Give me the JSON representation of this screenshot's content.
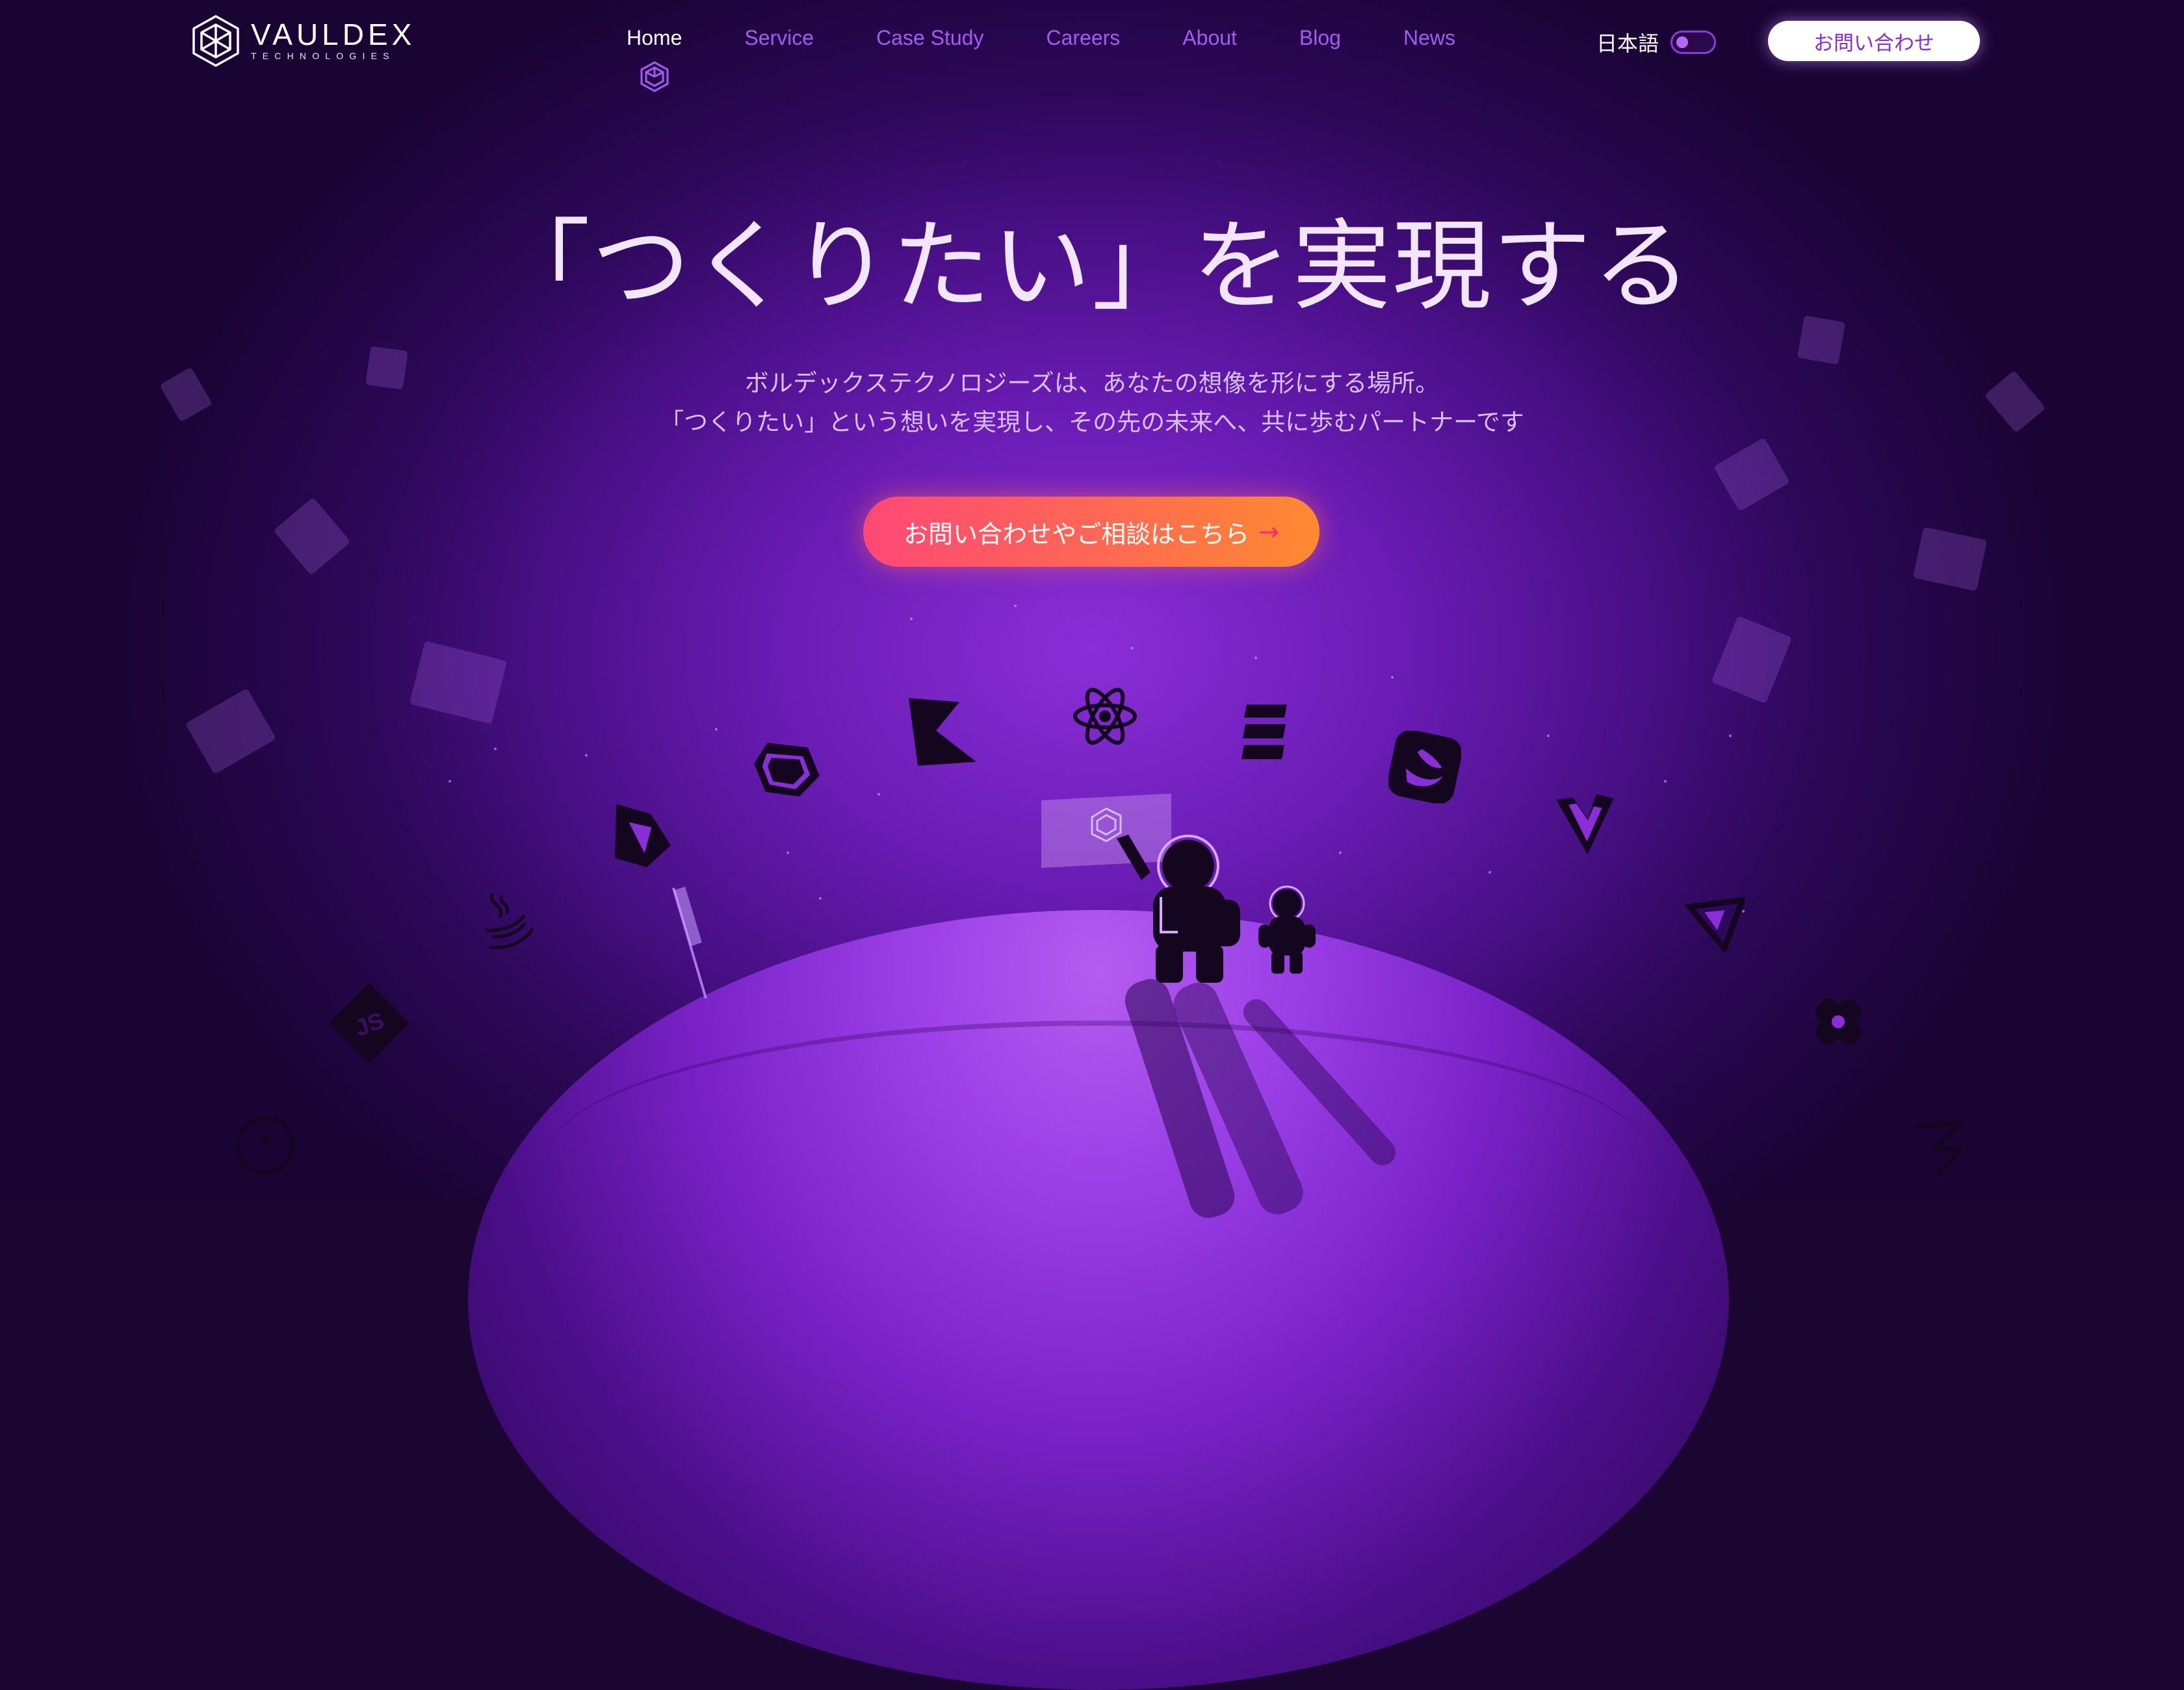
{
  "brand": {
    "name": "VAULDEX",
    "tagline": "TECHNOLOGIES"
  },
  "nav": {
    "items": [
      {
        "label": "Home",
        "active": true
      },
      {
        "label": "Service",
        "active": false
      },
      {
        "label": "Case Study",
        "active": false
      },
      {
        "label": "Careers",
        "active": false
      },
      {
        "label": "About",
        "active": false
      },
      {
        "label": "Blog",
        "active": false
      },
      {
        "label": "News",
        "active": false
      }
    ]
  },
  "language": {
    "label": "日本語"
  },
  "header_contact": {
    "label": "お問い合わせ"
  },
  "hero": {
    "title": "「つくりたい」を実現する",
    "subtitle_line1": "ボルデックステクノロジーズは、あなたの想像を形にする場所。",
    "subtitle_line2": "「つくりたい」という想いを実現し、その先の未来へ、共に歩むパートナーです",
    "cta_label": "お問い合わせやご相談はこちら",
    "cta_arrow": "→"
  },
  "tech_icons": [
    "firebase-icon",
    "dart-icon",
    "kotlin-icon",
    "react-icon",
    "ember-icon",
    "swift-icon",
    "vue-icon",
    "java-icon",
    "javascript-icon",
    "python-icon",
    "flutter-icon",
    "django-icon",
    "vite-icon"
  ],
  "colors": {
    "accent": "#a35cf2",
    "cta_start": "#ff4876",
    "cta_end": "#ff8a30",
    "background": "#1a0630"
  }
}
